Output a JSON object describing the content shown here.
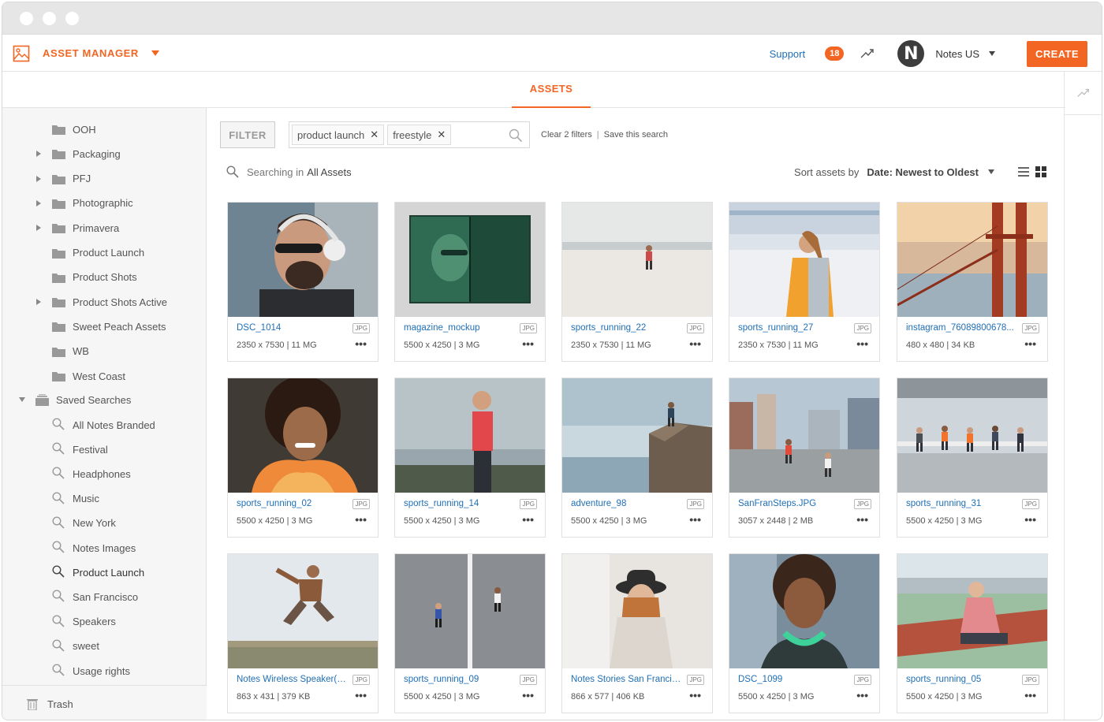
{
  "app": {
    "title": "ASSET MANAGER",
    "accent": "#f26522",
    "link_color": "#1f6fb5"
  },
  "topbar": {
    "support_label": "Support",
    "notification_count": "18",
    "avatar_letter": "N",
    "account_name": "Notes US",
    "create_label": "CREATE"
  },
  "tabs": {
    "assets_label": "ASSETS"
  },
  "sidebar": {
    "folders": [
      {
        "label": "OOH",
        "expandable": false
      },
      {
        "label": "Packaging",
        "expandable": true
      },
      {
        "label": "PFJ",
        "expandable": true
      },
      {
        "label": "Photographic",
        "expandable": true
      },
      {
        "label": "Primavera",
        "expandable": true
      },
      {
        "label": "Product Launch",
        "expandable": false
      },
      {
        "label": "Product Shots",
        "expandable": false
      },
      {
        "label": "Product Shots Active",
        "expandable": true
      },
      {
        "label": "Sweet Peach Assets",
        "expandable": false
      },
      {
        "label": "WB",
        "expandable": false
      },
      {
        "label": "West Coast",
        "expandable": false
      }
    ],
    "saved_searches_label": "Saved Searches",
    "saved_searches": [
      {
        "label": "All Notes Branded",
        "active": false
      },
      {
        "label": "Festival",
        "active": false
      },
      {
        "label": "Headphones",
        "active": false
      },
      {
        "label": "Music",
        "active": false
      },
      {
        "label": "New York",
        "active": false
      },
      {
        "label": "Notes Images",
        "active": false
      },
      {
        "label": "Product Launch",
        "active": true
      },
      {
        "label": "San Francisco",
        "active": false
      },
      {
        "label": "Speakers",
        "active": false
      },
      {
        "label": "sweet",
        "active": false
      },
      {
        "label": "Usage rights",
        "active": false
      }
    ],
    "trash_label": "Trash"
  },
  "filters": {
    "filter_label": "FILTER",
    "chips": [
      "product launch",
      "freestyle"
    ],
    "search_placeholder": "",
    "clear_label": "Clear 2 filters",
    "separator": "|",
    "save_label": "Save this search"
  },
  "search_status": {
    "prefix": "Searching in",
    "scope": "All Assets"
  },
  "sort": {
    "label": "Sort assets by",
    "value": "Date: Newest to Oldest"
  },
  "assets": [
    {
      "name": "DSC_1014",
      "type": "JPG",
      "meta": "2350 x 7530 | 11 MG",
      "scene": "portrait-headphones"
    },
    {
      "name": "magazine_mockup",
      "type": "JPG",
      "meta": "5500 x 4250 | 3 MG",
      "scene": "magazine"
    },
    {
      "name": "sports_running_22",
      "type": "JPG",
      "meta": "2350 x 7530 | 11 MG",
      "scene": "beach-runner"
    },
    {
      "name": "sports_running_27",
      "type": "JPG",
      "meta": "2350 x 7530 | 11 MG",
      "scene": "stadium-runner"
    },
    {
      "name": "instagram_76089800678...",
      "type": "JPG",
      "meta": "480 x 480 | 34 KB",
      "scene": "golden-gate"
    },
    {
      "name": "sports_running_02",
      "type": "JPG",
      "meta": "5500 x 4250 | 3 MG",
      "scene": "curly-orange"
    },
    {
      "name": "sports_running_14",
      "type": "JPG",
      "meta": "5500 x 4250 | 3 MG",
      "scene": "woman-red"
    },
    {
      "name": "adventure_98",
      "type": "JPG",
      "meta": "5500 x 4250 | 3 MG",
      "scene": "cliff"
    },
    {
      "name": "SanFranSteps.JPG",
      "type": "JPG",
      "meta": "3057 x 2448 | 2 MB",
      "scene": "city-runners"
    },
    {
      "name": "sports_running_31",
      "type": "JPG",
      "meta": "5500 x 4250 | 3 MG",
      "scene": "group-runners"
    },
    {
      "name": "Notes Wireless Speaker(e...",
      "type": "JPG",
      "meta": "863 x 431 | 379 KB",
      "scene": "jumper"
    },
    {
      "name": "sports_running_09",
      "type": "JPG",
      "meta": "5500 x 4250 | 3 MG",
      "scene": "road-runners"
    },
    {
      "name": "Notes Stories San Francis...",
      "type": "JPG",
      "meta": "866 x 577 | 406 KB",
      "scene": "woman-hat"
    },
    {
      "name": "DSC_1099",
      "type": "JPG",
      "meta": "5500 x 4250 | 3 MG",
      "scene": "woman-green-headphones"
    },
    {
      "name": "sports_running_05",
      "type": "JPG",
      "meta": "5500 x 4250 | 3 MG",
      "scene": "track-shoe"
    }
  ]
}
